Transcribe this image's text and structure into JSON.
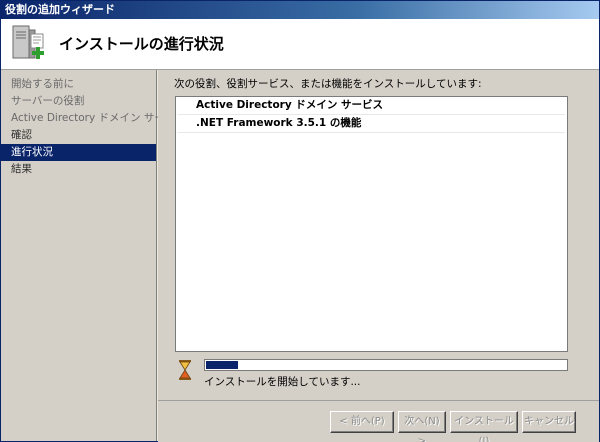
{
  "window": {
    "title": "役割の追加ウィザード"
  },
  "header": {
    "title": "インストールの進行状況",
    "icon": "server-add-icon"
  },
  "sidebar": {
    "items": [
      {
        "label": "開始する前に",
        "state": "done"
      },
      {
        "label": "サーバーの役割",
        "state": "done"
      },
      {
        "label": "Active Directory ドメイン サービス",
        "state": "done"
      },
      {
        "label": "確認",
        "state": "plain"
      },
      {
        "label": "進行状況",
        "state": "current"
      },
      {
        "label": "結果",
        "state": "plain"
      }
    ]
  },
  "main": {
    "heading": "次の役割、役割サービス、または機能をインストールしています:",
    "items": [
      {
        "label": "Active Directory ドメイン サービス"
      },
      {
        "label": ".NET Framework 3.5.1 の機能"
      }
    ],
    "progress": {
      "fraction": 0.09,
      "status_text": "インストールを開始しています..."
    }
  },
  "footer": {
    "back_label": "< 前へ(P)",
    "next_label": "次へ(N) >",
    "install_label": "インストール(I)",
    "cancel_label": "キャンセル"
  },
  "colors": {
    "selection": "#0a246a",
    "progress_fill": "#0a246a",
    "accent_green": "#2e9e2e"
  }
}
